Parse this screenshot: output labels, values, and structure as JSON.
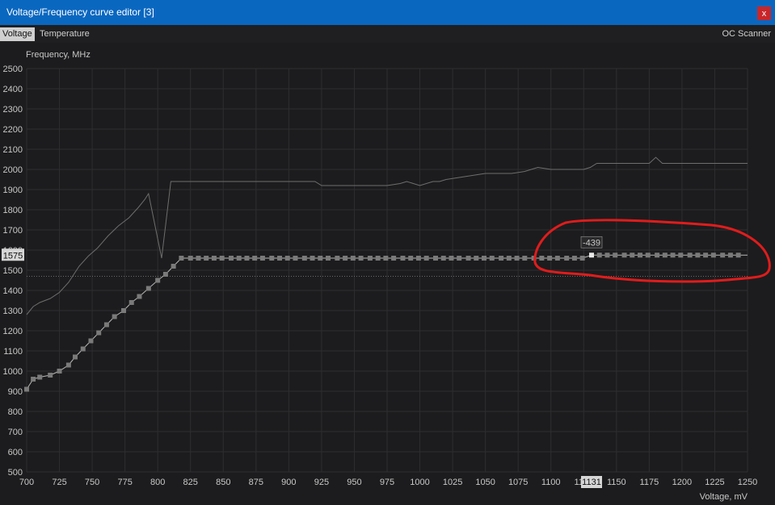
{
  "window": {
    "title": "Voltage/Frequency curve editor [3]",
    "close_label": "x"
  },
  "tabs": [
    {
      "label": "Voltage",
      "active": true
    },
    {
      "label": "Temperature",
      "active": false
    }
  ],
  "oc_scanner_label": "OC Scanner",
  "colors": {
    "titlebar": "#0a67c0",
    "close": "#c8272a",
    "background": "#1c1c1e",
    "grid": "#2e2e31",
    "curve": "#8c8c8c",
    "point": "#7a7a7a",
    "annotation": "#e01c1c"
  },
  "chart_data": {
    "type": "line",
    "xlabel": "Voltage, mV",
    "ylabel": "Frequency, MHz",
    "xlim": [
      700,
      1250
    ],
    "ylim": [
      500,
      2500
    ],
    "grid": true,
    "x_ticks": [
      700,
      725,
      750,
      775,
      800,
      825,
      850,
      875,
      900,
      925,
      950,
      975,
      1000,
      1025,
      1050,
      1075,
      1100,
      1125,
      1150,
      1175,
      1200,
      1225,
      1250
    ],
    "y_ticks": [
      500,
      600,
      700,
      800,
      900,
      1000,
      1100,
      1200,
      1300,
      1400,
      1500,
      1600,
      1700,
      1800,
      1900,
      2000,
      2100,
      2200,
      2300,
      2400,
      2500
    ],
    "selected_voltage_label": "1131",
    "selected_frequency_label": "1575",
    "offset_label": "-439",
    "reference_line_mhz": 1470,
    "series": [
      {
        "kind": "reference",
        "x": [
          700,
          705,
          710,
          718,
          725,
          732,
          740,
          747,
          754,
          762,
          770,
          778,
          785,
          790,
          793,
          803,
          810,
          830,
          850,
          880,
          900,
          920,
          925,
          950,
          975,
          985,
          990,
          995,
          1000,
          1010,
          1015,
          1020,
          1030,
          1040,
          1050,
          1060,
          1070,
          1080,
          1085,
          1090,
          1100,
          1110,
          1125,
          1130,
          1135,
          1150,
          1175,
          1180,
          1185,
          1200,
          1225,
          1250
        ],
        "y": [
          1280,
          1320,
          1340,
          1360,
          1390,
          1440,
          1520,
          1570,
          1610,
          1670,
          1720,
          1760,
          1810,
          1850,
          1880,
          1560,
          1940,
          1940,
          1940,
          1940,
          1940,
          1940,
          1920,
          1920,
          1920,
          1930,
          1940,
          1930,
          1920,
          1940,
          1940,
          1950,
          1960,
          1970,
          1980,
          1980,
          1980,
          1990,
          2000,
          2010,
          2000,
          2000,
          2000,
          2010,
          2030,
          2030,
          2030,
          2060,
          2030,
          2030,
          2030,
          2030
        ]
      },
      {
        "kind": "points",
        "x": [
          700,
          705,
          710,
          718,
          725,
          732,
          737,
          743,
          749,
          755,
          761,
          767,
          774,
          780,
          786,
          793,
          800,
          806,
          812,
          818,
          825,
          831,
          837,
          843,
          849,
          856,
          862,
          868,
          874,
          880,
          887,
          893,
          899,
          905,
          912,
          918,
          924,
          930,
          937,
          943,
          949,
          955,
          962,
          968,
          974,
          980,
          987,
          993,
          999,
          1005,
          1012,
          1018,
          1024,
          1030,
          1037,
          1043,
          1049,
          1055,
          1062,
          1068,
          1074,
          1080,
          1087,
          1093,
          1099,
          1105,
          1112,
          1118,
          1124,
          1131,
          1137,
          1143,
          1149,
          1156,
          1162,
          1168,
          1174,
          1181,
          1187,
          1193,
          1199,
          1206,
          1212,
          1218,
          1224,
          1231,
          1237,
          1243
        ],
        "y": [
          910,
          960,
          970,
          980,
          1000,
          1030,
          1070,
          1110,
          1150,
          1190,
          1230,
          1270,
          1300,
          1340,
          1370,
          1410,
          1450,
          1480,
          1520,
          1560,
          1560,
          1560,
          1560,
          1560,
          1560,
          1560,
          1560,
          1560,
          1560,
          1560,
          1560,
          1560,
          1560,
          1560,
          1560,
          1560,
          1560,
          1560,
          1560,
          1560,
          1560,
          1560,
          1560,
          1560,
          1560,
          1560,
          1560,
          1560,
          1560,
          1560,
          1560,
          1560,
          1560,
          1560,
          1560,
          1560,
          1560,
          1560,
          1560,
          1560,
          1560,
          1560,
          1560,
          1560,
          1560,
          1560,
          1560,
          1560,
          1560,
          1575,
          1575,
          1575,
          1575,
          1575,
          1575,
          1575,
          1575,
          1575,
          1575,
          1575,
          1575,
          1575,
          1575,
          1575,
          1575,
          1575,
          1575,
          1575
        ]
      }
    ]
  }
}
